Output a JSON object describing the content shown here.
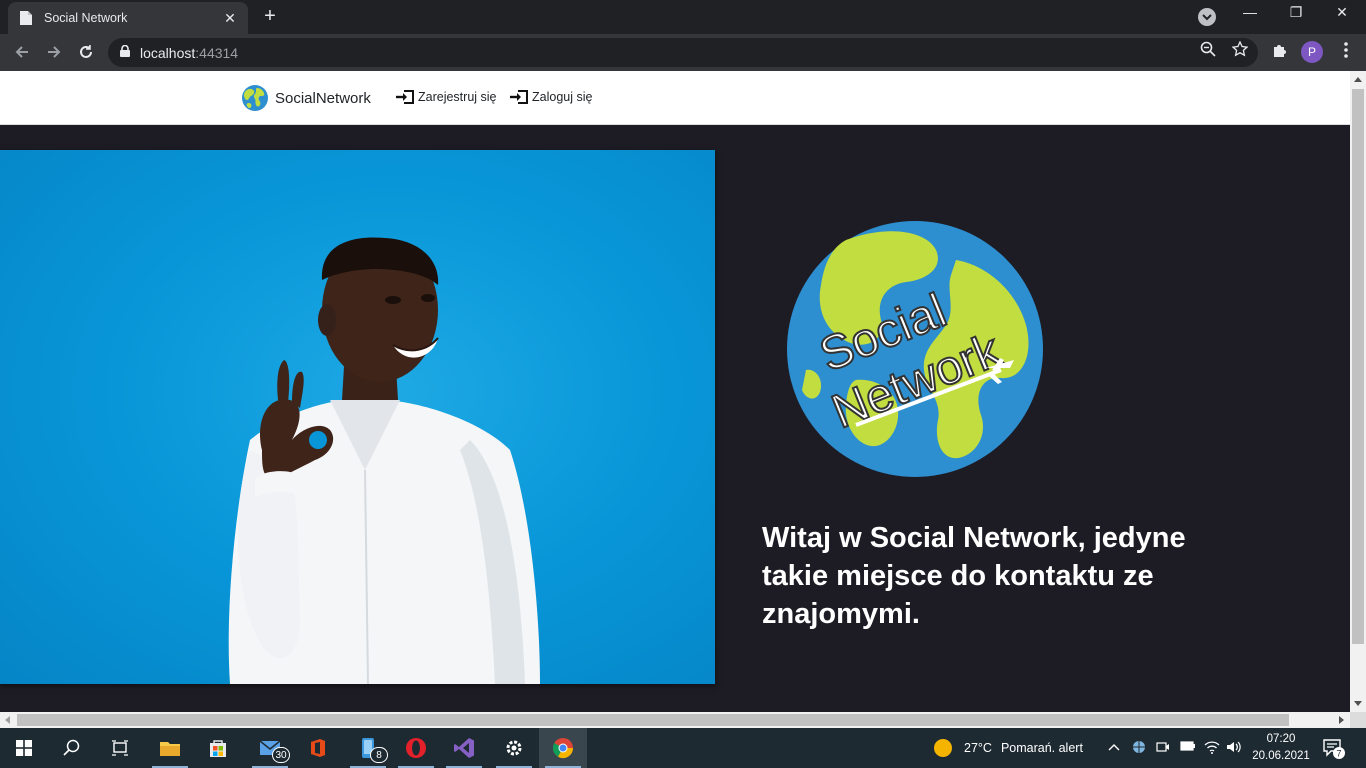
{
  "browser": {
    "tab_title": "Social Network",
    "tab_close": "✕",
    "new_tab": "+",
    "url_host": "localhost",
    "url_port": ":44314",
    "profile_initial": "P",
    "minimize": "—",
    "restore": "❐",
    "close": "✕"
  },
  "navbar": {
    "brand": "SocialNetwork",
    "links": [
      {
        "label": "Zarejestruj się",
        "icon": "sign-in-icon"
      },
      {
        "label": "Zaloguj się",
        "icon": "sign-in-icon"
      }
    ]
  },
  "hero": {
    "logo_text_line1": "Social",
    "logo_text_line2": "Network",
    "headline": "Witaj w Social Network, jedyne takie miejsce do kontaktu ze znajomymi."
  },
  "taskbar": {
    "mail_badge": "30",
    "files_badge": "8",
    "weather_temp": "27°C",
    "weather_alert": "Pomarań. alert",
    "time": "07:20",
    "date": "20.06.2021",
    "notification_count": "7"
  },
  "colors": {
    "page_bg": "#1d1c24",
    "hero_blue": "#0896d8",
    "globe_ocean": "#2d8fd0",
    "globe_land": "#c2dd3f"
  }
}
